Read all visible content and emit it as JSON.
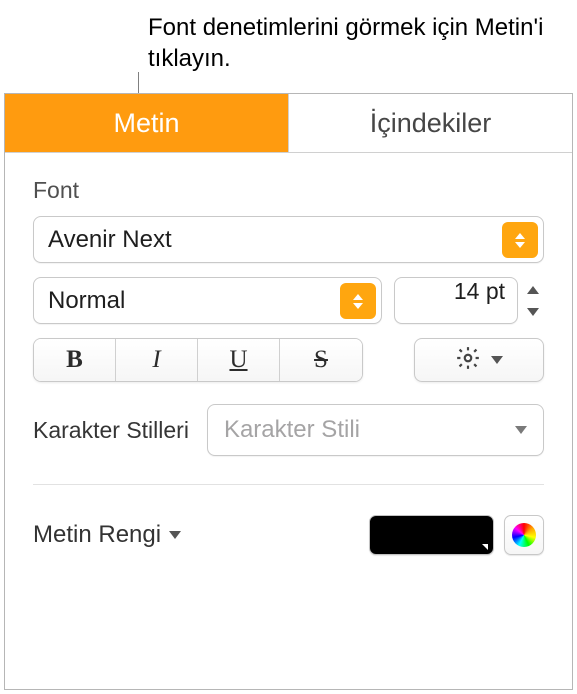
{
  "callout": "Font denetimlerini görmek için Metin'i tıklayın.",
  "tabs": {
    "text": "Metin",
    "toc": "İçindekiler"
  },
  "font": {
    "section_label": "Font",
    "family": "Avenir Next",
    "style": "Normal",
    "size": "14 pt",
    "bold_glyph": "B",
    "italic_glyph": "I",
    "underline_glyph": "U",
    "strike_glyph": "S"
  },
  "character_styles": {
    "label": "Karakter Stilleri",
    "placeholder": "Karakter Stili"
  },
  "text_color": {
    "label": "Metin Rengi",
    "value": "#000000"
  }
}
